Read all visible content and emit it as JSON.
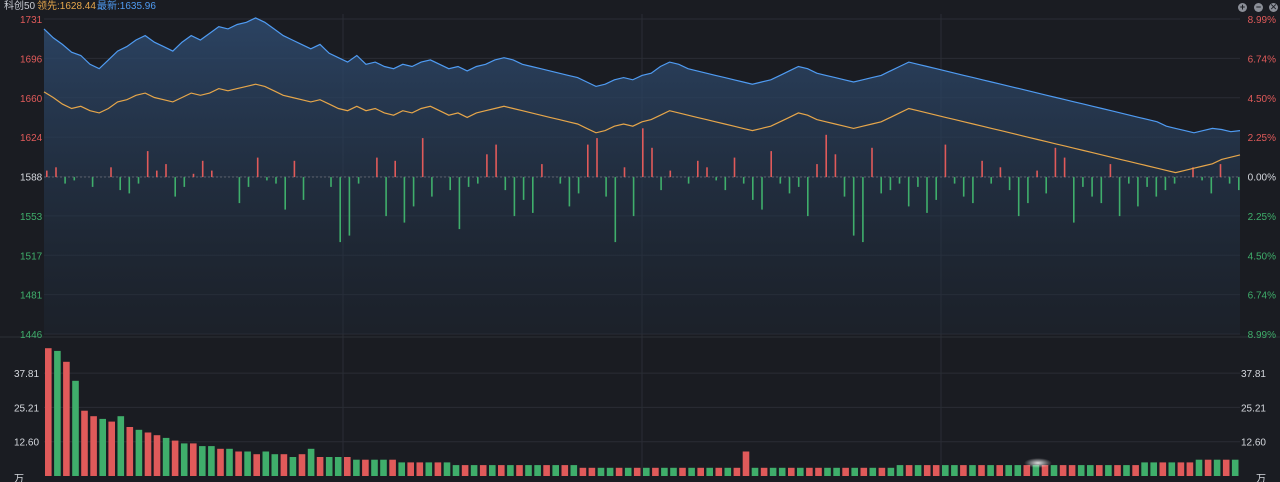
{
  "header": {
    "index_name": "科创50",
    "lead_label": "领先:1628.44",
    "latest_label": "最新:1635.96"
  },
  "controls": [
    {
      "name": "zoom-in",
      "glyph": "+"
    },
    {
      "name": "zoom-out",
      "glyph": "−"
    },
    {
      "name": "settings",
      "glyph": "✕"
    }
  ],
  "colors": {
    "up": "#e05a5a",
    "down": "#3fae6b",
    "latest_line": "#4f9bf2",
    "lead_line": "#e6a64a",
    "axis_text_up": "#e05a5a",
    "axis_text_down": "#3fae6b",
    "axis_text_neutral": "#d5d8de",
    "grid": "#2a2d35"
  },
  "chart_data": [
    {
      "type": "line",
      "title": "",
      "y_axis_left": {
        "ticks": [
          "1731",
          "1696",
          "1660",
          "1624",
          "1588",
          "1553",
          "1517",
          "1481",
          "1446"
        ],
        "range": [
          1446,
          1731
        ]
      },
      "y_axis_right": {
        "ticks": [
          "8.99%",
          "6.74%",
          "4.50%",
          "2.25%",
          "0.00%",
          "2.25%",
          "4.50%",
          "6.74%",
          "8.99%"
        ]
      },
      "prev_close": 1588,
      "grid": true,
      "series": [
        {
          "name": "最新",
          "values": [
            1722,
            1714,
            1708,
            1701,
            1698,
            1690,
            1686,
            1694,
            1702,
            1706,
            1712,
            1716,
            1710,
            1706,
            1702,
            1710,
            1716,
            1712,
            1718,
            1724,
            1722,
            1726,
            1728,
            1732,
            1728,
            1722,
            1716,
            1712,
            1708,
            1704,
            1708,
            1700,
            1696,
            1692,
            1698,
            1690,
            1692,
            1688,
            1686,
            1690,
            1688,
            1692,
            1694,
            1690,
            1686,
            1688,
            1684,
            1688,
            1690,
            1694,
            1696,
            1694,
            1690,
            1688,
            1686,
            1684,
            1682,
            1680,
            1678,
            1674,
            1670,
            1672,
            1676,
            1678,
            1676,
            1680,
            1682,
            1688,
            1692,
            1690,
            1686,
            1684,
            1682,
            1680,
            1678,
            1676,
            1674,
            1672,
            1674,
            1676,
            1680,
            1684,
            1688,
            1686,
            1682,
            1680,
            1678,
            1676,
            1674,
            1676,
            1678,
            1680,
            1684,
            1688,
            1692,
            1690,
            1688,
            1686,
            1684,
            1682,
            1680,
            1678,
            1676,
            1674,
            1672,
            1670,
            1668,
            1666,
            1664,
            1662,
            1660,
            1658,
            1656,
            1654,
            1652,
            1650,
            1648,
            1646,
            1644,
            1642,
            1640,
            1638,
            1634,
            1632,
            1630,
            1628,
            1630,
            1632,
            1631,
            1629,
            1630
          ],
          "color": "#4f9bf2"
        },
        {
          "name": "领先",
          "values": [
            1665,
            1660,
            1654,
            1650,
            1652,
            1648,
            1646,
            1650,
            1656,
            1658,
            1662,
            1664,
            1660,
            1658,
            1656,
            1660,
            1664,
            1662,
            1664,
            1668,
            1666,
            1668,
            1670,
            1672,
            1670,
            1666,
            1662,
            1660,
            1658,
            1656,
            1658,
            1654,
            1650,
            1648,
            1652,
            1648,
            1650,
            1646,
            1644,
            1648,
            1646,
            1650,
            1652,
            1648,
            1644,
            1646,
            1642,
            1646,
            1648,
            1650,
            1652,
            1650,
            1648,
            1646,
            1644,
            1642,
            1640,
            1638,
            1636,
            1632,
            1628,
            1630,
            1634,
            1636,
            1634,
            1638,
            1640,
            1644,
            1648,
            1646,
            1644,
            1642,
            1640,
            1638,
            1636,
            1634,
            1632,
            1630,
            1632,
            1634,
            1638,
            1642,
            1646,
            1644,
            1640,
            1638,
            1636,
            1634,
            1632,
            1634,
            1636,
            1638,
            1642,
            1646,
            1650,
            1648,
            1646,
            1644,
            1642,
            1640,
            1638,
            1636,
            1634,
            1632,
            1630,
            1628,
            1626,
            1624,
            1622,
            1620,
            1618,
            1616,
            1614,
            1612,
            1610,
            1608,
            1606,
            1604,
            1602,
            1600,
            1598,
            1596,
            1594,
            1592,
            1594,
            1596,
            1598,
            1600,
            1604,
            1606,
            1608
          ],
          "color": "#e6a64a"
        }
      ],
      "breadth_bars": [
        2,
        3,
        -2,
        -1,
        0,
        -3,
        0,
        3,
        -4,
        -5,
        -2,
        8,
        2,
        4,
        -6,
        -3,
        1,
        5,
        2,
        0,
        0,
        -8,
        -3,
        6,
        -1,
        -2,
        -10,
        5,
        -7,
        0,
        0,
        -3,
        -20,
        -18,
        -2,
        0,
        6,
        -12,
        5,
        -14,
        -9,
        12,
        -6,
        0,
        -4,
        -16,
        -3,
        -2,
        7,
        10,
        -4,
        -12,
        -7,
        -11,
        4,
        0,
        -2,
        -9,
        -5,
        10,
        12,
        -6,
        -20,
        3,
        -12,
        15,
        9,
        -4,
        2,
        0,
        -2,
        5,
        3,
        -1,
        -4,
        6,
        -2,
        -7,
        -10,
        8,
        -2,
        -5,
        -3,
        -12,
        4,
        13,
        7,
        -6,
        -18,
        -20,
        9,
        -5,
        -4,
        -2,
        -9,
        -3,
        -11,
        -7,
        10,
        -2,
        -6,
        -8,
        5,
        -2,
        3,
        -4,
        -12,
        -8,
        2,
        -5,
        9,
        6,
        -14,
        -3,
        -6,
        -8,
        4,
        -12,
        -2,
        -9,
        -3,
        -6,
        -4,
        -2,
        0,
        3,
        -1,
        -5,
        4,
        -2,
        -4
      ],
      "breadth_range": [
        -20,
        20
      ]
    },
    {
      "type": "bar",
      "title": "",
      "unit_label": "万",
      "y_axis_left": {
        "ticks": [
          "37.81",
          "25.21",
          "12.60",
          "万"
        ]
      },
      "y_axis_right": {
        "ticks": [
          "37.81",
          "25.21",
          "12.60",
          "万"
        ]
      },
      "ylim": [
        0,
        50
      ],
      "volumes": [
        47,
        46,
        42,
        35,
        24,
        22,
        21,
        20,
        22,
        18,
        17,
        16,
        15,
        14,
        13,
        12,
        12,
        11,
        11,
        10,
        10,
        9,
        9,
        8,
        9,
        8,
        8,
        7,
        8,
        10,
        7,
        7,
        7,
        7,
        6,
        6,
        6,
        6,
        6,
        5,
        5,
        5,
        5,
        5,
        5,
        4,
        4,
        4,
        4,
        4,
        4,
        4,
        4,
        4,
        4,
        4,
        4,
        4,
        4,
        3,
        3,
        3,
        3,
        3,
        3,
        3,
        3,
        3,
        3,
        3,
        3,
        3,
        3,
        3,
        3,
        3,
        3,
        9,
        3,
        3,
        3,
        3,
        3,
        3,
        3,
        3,
        3,
        3,
        3,
        3,
        3,
        3,
        3,
        3,
        4,
        4,
        4,
        4,
        4,
        4,
        4,
        4,
        4,
        4,
        4,
        4,
        4,
        4,
        4,
        4,
        4,
        4,
        4,
        4,
        4,
        4,
        4,
        4,
        4,
        4,
        4,
        5,
        5,
        5,
        5,
        5,
        5,
        6,
        6,
        6,
        6,
        6
      ],
      "volume_up": [
        1,
        0,
        1,
        0,
        1,
        1,
        0,
        1,
        0,
        1,
        0,
        1,
        1,
        0,
        1,
        0,
        1,
        0,
        0,
        1,
        0,
        1,
        0,
        1,
        0,
        0,
        1,
        0,
        1,
        0,
        1,
        0,
        0,
        1,
        0,
        1,
        0,
        0,
        1,
        0,
        1,
        1,
        0,
        1,
        0,
        0,
        1,
        0,
        1,
        0,
        1,
        0,
        1,
        0,
        0,
        1,
        0,
        1,
        0,
        1,
        1,
        0,
        0,
        1,
        0,
        1,
        0,
        1,
        0,
        0,
        1,
        0,
        1,
        0,
        1,
        0,
        1,
        1,
        0,
        1,
        0,
        0,
        1,
        0,
        1,
        1,
        0,
        0,
        1,
        0,
        1,
        0,
        1,
        0,
        0,
        1,
        0,
        1,
        1,
        0,
        0,
        1,
        0,
        1,
        0,
        1,
        0,
        0,
        1,
        0,
        1,
        0,
        1,
        1,
        0,
        0,
        1,
        0,
        1,
        0,
        1,
        0,
        0,
        1,
        0,
        1,
        1,
        0,
        1,
        0,
        1
      ]
    }
  ]
}
